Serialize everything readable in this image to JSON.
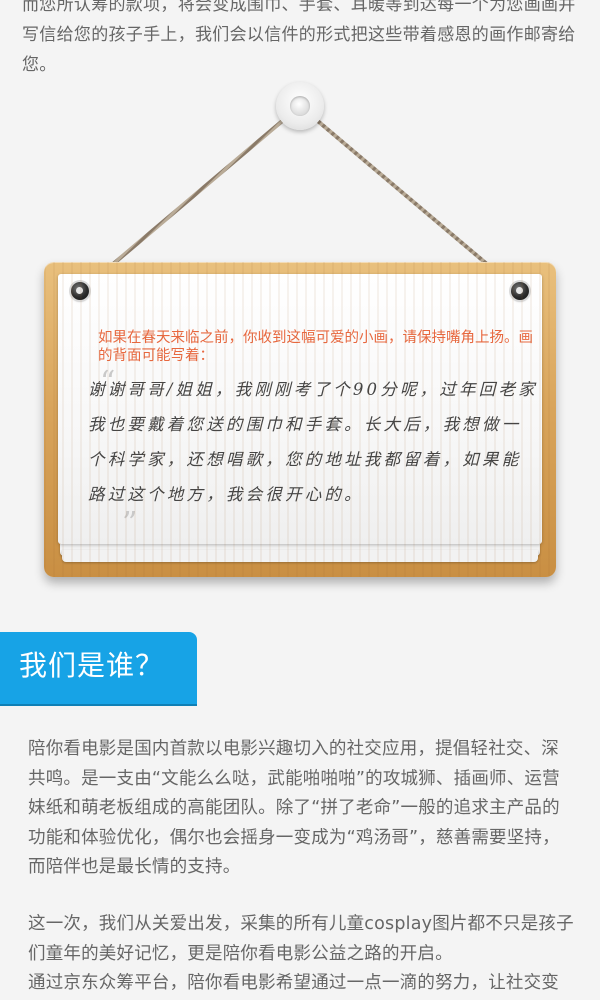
{
  "intro_text": "而您所认筹的款项，将会变成围巾、手套、耳暖等到达每一个为您画画并写信给您的孩子手上，我们会以信件的形式把这些带着感恩的画作邮寄给您。",
  "sign": {
    "note": "如果在春天来临之前，你收到这幅可爱的小画，请保持嘴角上扬。画的背面可能写着：",
    "open_quote": "“",
    "handwritten": "谢谢哥哥/姐姐，我刚刚考了个90分呢，过年回老家我也要戴着您送的围巾和手套。长大后，我想做一个科学家，还想唱歌，您的地址我都留着，如果能路过这个地方，我会很开心的。",
    "close_quote": "”"
  },
  "section": {
    "title": "我们是谁？",
    "paragraphs": [
      "陪你看电影是国内首款以电影兴趣切入的社交应用，提倡轻社交、深共鸣。是一支由“文能么么哒，武能啪啪啪”的攻城狮、插画师、运营妹纸和萌老板组成的高能团队。除了“拼了老命”一般的追求主产品的功能和体验优化，偶尔也会摇身一变成为“鸡汤哥”，慈善需要坚持，而陪伴也是最长情的支持。",
      "这一次，我们从关爱出发，采集的所有儿童cosplay图片都不只是孩子们童年的美好记忆，更是陪你看电影公益之路的开启。",
      "通过京东众筹平台，陪你看电影希望通过一点一滴的努力，让社交变"
    ]
  },
  "colors": {
    "accent_blue": "#17a3e6",
    "note_orange": "#e8683f",
    "body_text": "#666666"
  }
}
